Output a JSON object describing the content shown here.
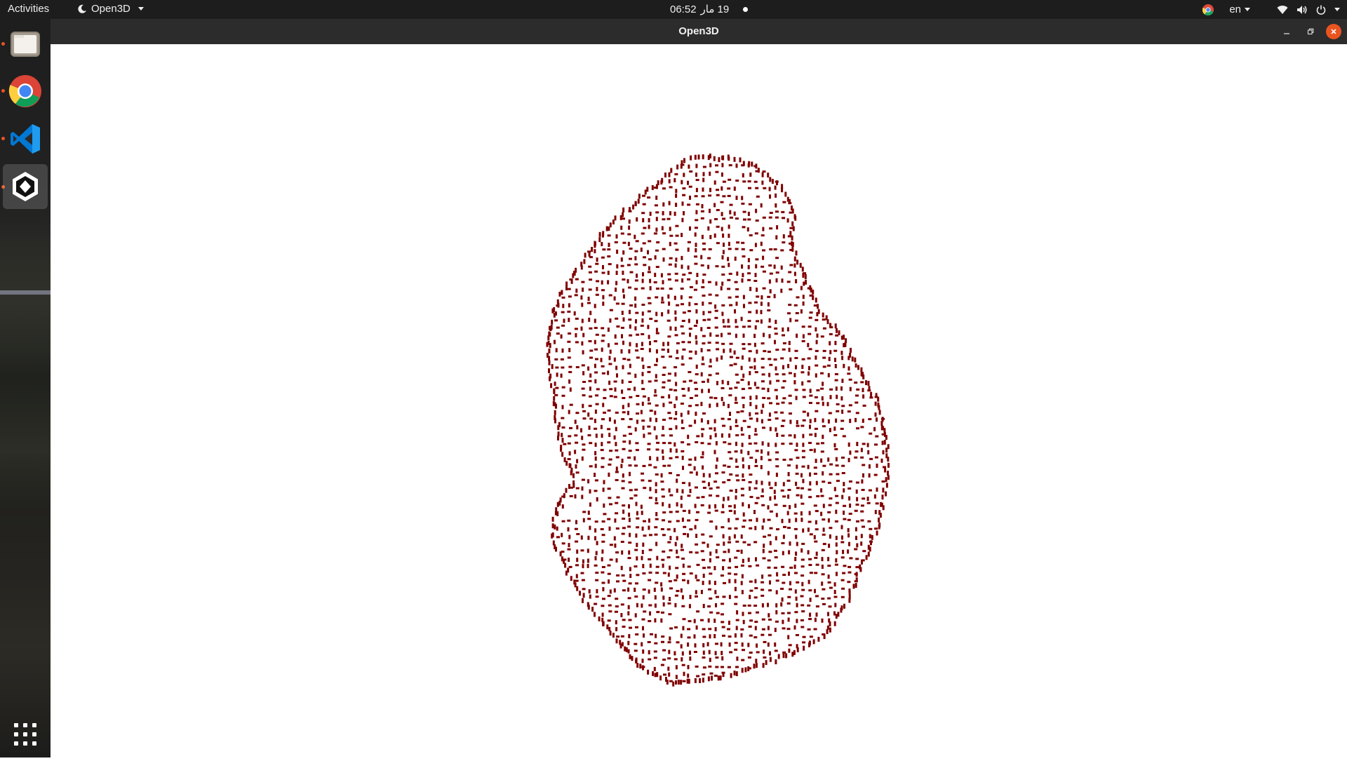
{
  "topbar": {
    "activities_label": "Activities",
    "app_menu_label": "Open3D",
    "clock_time": "06:52",
    "clock_date": "19 مار",
    "language": "en"
  },
  "dock": {
    "items": [
      {
        "name": "files",
        "icon": "folder-icon"
      },
      {
        "name": "chrome",
        "icon": "chrome-icon"
      },
      {
        "name": "vscode",
        "icon": "vscode-icon"
      },
      {
        "name": "open3d",
        "icon": "open3d-icon"
      }
    ],
    "show_apps_icon": "grid-icon"
  },
  "window": {
    "title": "Open3D",
    "background": "#ffffff",
    "point_color": "#800000"
  },
  "colors": {
    "topbar_bg": "#1d1d1d",
    "titlebar_bg": "#2c2c2c",
    "accent": "#e95420"
  }
}
